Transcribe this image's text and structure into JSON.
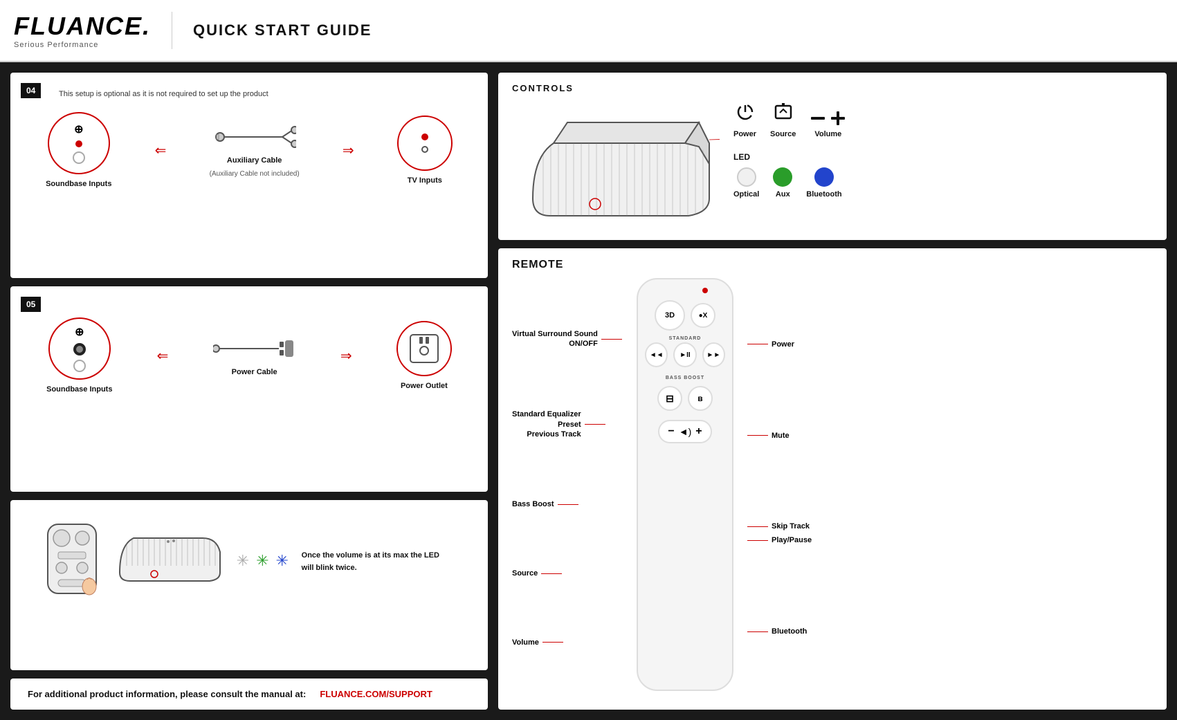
{
  "header": {
    "logo": "FLUANCE.",
    "tagline": "Serious Performance",
    "title": "QUICK START GUIDE"
  },
  "step04": {
    "badge": "04",
    "note": "This setup is optional as it is not required to set up the product",
    "soundbase_label": "Soundbase Inputs",
    "cable_label": "Auxiliary Cable",
    "cable_sub": "(Auxiliary Cable not included)",
    "tv_label": "TV Inputs"
  },
  "step05": {
    "badge": "05",
    "soundbase_label": "Soundbase Inputs",
    "cable_label": "Power Cable",
    "outlet_label": "Power Outlet"
  },
  "step06": {
    "description": "Once the volume is at its max the LED will blink twice."
  },
  "controls": {
    "title": "CONTROLS",
    "power_label": "Power",
    "source_label": "Source",
    "volume_label": "Volume",
    "led_title": "LED",
    "optical_label": "Optical",
    "aux_label": "Aux",
    "bluetooth_label": "Bluetooth"
  },
  "remote": {
    "title": "REMOTE",
    "labels_left": {
      "virtual_surround": "Virtual Surround Sound\nON/OFF",
      "std_eq": "Standard Equalizer\nPreset",
      "prev_track": "Previous Track",
      "bass_boost": "Bass Boost",
      "source": "Source",
      "volume": "Volume"
    },
    "labels_right": {
      "power": "Power",
      "mute": "Mute",
      "skip_track": "Skip Track",
      "play_pause": "Play/Pause",
      "bluetooth": "Bluetooth"
    },
    "btn_3d": "3D",
    "btn_mute": "●X",
    "btn_standard": "STANDARD",
    "btn_prev": "◄◄",
    "btn_play": "►II",
    "btn_next": "►►",
    "btn_bass_boost": "BASS BOOST",
    "btn_source": "⊟",
    "btn_bt": "ɮ",
    "btn_vol_minus": "−",
    "btn_vol_speaker": "◄)",
    "btn_vol_plus": "+"
  },
  "footer": {
    "text": "For additional product information, please consult the manual at:",
    "link": "FLUANCE.COM/SUPPORT"
  },
  "colors": {
    "red": "#cc0000",
    "white_led": "#f0f0f0",
    "green_led": "#2a9d2a",
    "blue_led": "#2244cc",
    "dark_bg": "#1a1a1a"
  }
}
